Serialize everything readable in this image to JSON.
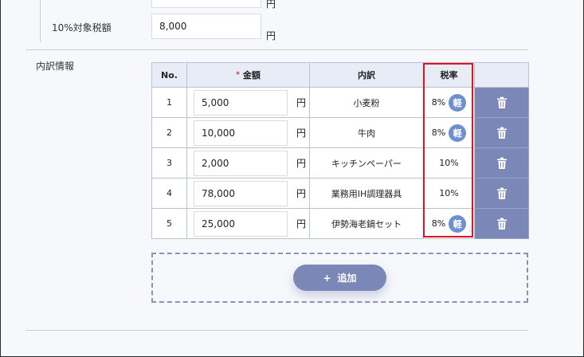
{
  "tax_section": {
    "top_unit": "円",
    "tax10_label": "10%対象税額",
    "tax10_value": "8,000",
    "tax10_unit": "円"
  },
  "breakdown": {
    "section_label": "内訳情報",
    "headers": {
      "no": "No.",
      "required_mark": "*",
      "amount": "金額",
      "item": "内訳",
      "tax_rate": "税率"
    },
    "rows": [
      {
        "no": "1",
        "amount": "5,000",
        "unit": "円",
        "item": "小麦粉",
        "rate": "8%",
        "reduced": "軽"
      },
      {
        "no": "2",
        "amount": "10,000",
        "unit": "円",
        "item": "牛肉",
        "rate": "8%",
        "reduced": "軽"
      },
      {
        "no": "3",
        "amount": "2,000",
        "unit": "円",
        "item": "キッチンペーパー",
        "rate": "10%",
        "reduced": ""
      },
      {
        "no": "4",
        "amount": "78,000",
        "unit": "円",
        "item": "業務用IH調理器具",
        "rate": "10%",
        "reduced": ""
      },
      {
        "no": "5",
        "amount": "25,000",
        "unit": "円",
        "item": "伊勢海老鍋セット",
        "rate": "8%",
        "reduced": "軽"
      }
    ],
    "add_button": {
      "icon": "+",
      "label": "追加"
    },
    "icons": {
      "delete": "trash-icon",
      "reduced": "reduced-rate-badge"
    },
    "colors": {
      "header_bg": "#e7ecf6",
      "delete_bg": "#7b87b6",
      "badge": "#6f8fd3",
      "highlight": "#e0141b",
      "required": "#e02a2a"
    }
  }
}
